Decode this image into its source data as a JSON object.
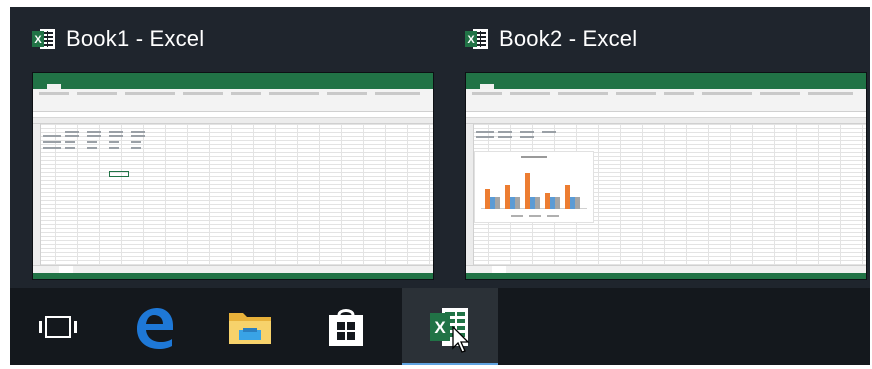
{
  "previews": [
    {
      "title": "Book1 - Excel"
    },
    {
      "title": "Book2 - Excel"
    }
  ],
  "taskbar": {
    "items": [
      {
        "name": "Task View"
      },
      {
        "name": "Microsoft Edge"
      },
      {
        "name": "File Explorer"
      },
      {
        "name": "Store"
      },
      {
        "name": "Excel",
        "active": true
      }
    ]
  },
  "colors": {
    "excel_green": "#217346",
    "edge_blue": "#1e78d7",
    "chart_orange": "#ed7d31",
    "chart_blue": "#5b9bd5",
    "chart_gray": "#a5a5a5"
  },
  "chart_data": {
    "type": "bar",
    "categories": [
      "",
      "",
      "",
      "",
      ""
    ],
    "series": [
      {
        "values": [
          5,
          6,
          9,
          4,
          6
        ]
      },
      {
        "values": [
          3,
          3,
          3,
          3,
          3
        ]
      },
      {
        "values": [
          3,
          3,
          3,
          3,
          3
        ]
      }
    ]
  }
}
